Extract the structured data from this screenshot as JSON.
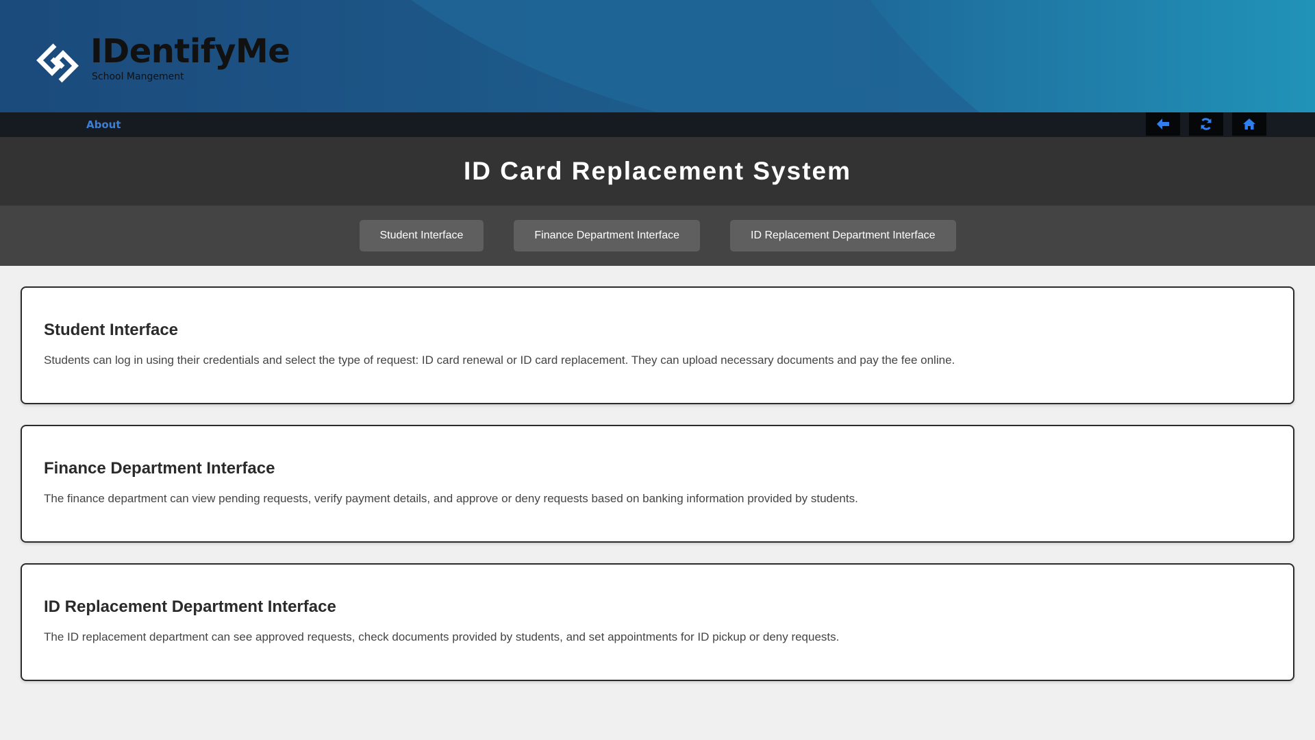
{
  "brand": {
    "name": "IDentifyMe",
    "subtitle": "School Mangement"
  },
  "nav": {
    "about_label": "About",
    "buttons": [
      {
        "icon": "arrow-left-icon"
      },
      {
        "icon": "refresh-icon"
      },
      {
        "icon": "home-icon"
      }
    ]
  },
  "page": {
    "title": "ID Card Replacement System"
  },
  "tabs": [
    {
      "label": "Student Interface"
    },
    {
      "label": "Finance Department Interface"
    },
    {
      "label": "ID Replacement Department Interface"
    }
  ],
  "sections": [
    {
      "title": "Student Interface",
      "description": "Students can log in using their credentials and select the type of request: ID card renewal or ID card replacement. They can upload necessary documents and pay the fee online."
    },
    {
      "title": "Finance Department Interface",
      "description": "The finance department can view pending requests, verify payment details, and approve or deny requests based on banking information provided by students."
    },
    {
      "title": "ID Replacement Department Interface",
      "description": "The ID replacement department can see approved requests, check documents provided by students, and set appointments for ID pickup or deny requests."
    }
  ],
  "colors": {
    "header_dark": "#1d4f7f",
    "header_light": "#2196b8",
    "nav_bg": "#161b22",
    "accent_blue": "#3a7fd8",
    "title_bar": "#333333",
    "tabs_bar": "#444444",
    "tab_button": "#5f5f5f"
  }
}
